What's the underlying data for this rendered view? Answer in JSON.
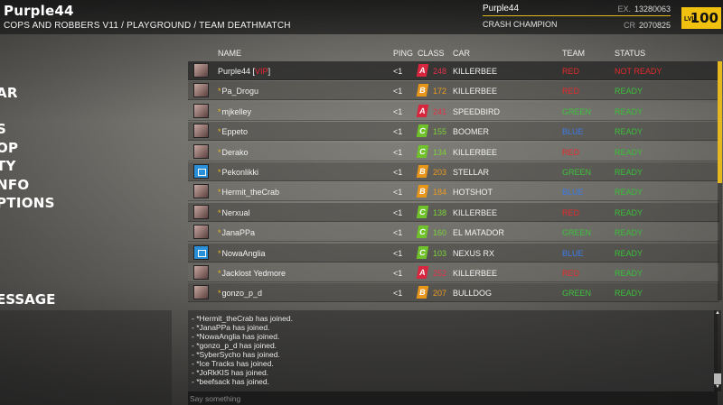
{
  "header": {
    "player_title": "Purple44",
    "breadcrumb": "COPS AND ROBBERS V11 / PLAYGROUND / TEAM DEATHMATCH"
  },
  "profile": {
    "name": "Purple44",
    "rank": "CRASH CHAMPION",
    "ex_label": "EX.",
    "ex_value": "13280063",
    "cr_label": "CR",
    "cr_value": "2070825",
    "lvl_label": "LVL",
    "lvl_value": "100"
  },
  "side_menu": {
    "items": [
      "AR",
      "S",
      "OP",
      "TY",
      "NFO",
      "PTIONS"
    ],
    "message_label": "ESSAGE"
  },
  "columns": {
    "name": "NAME",
    "ping": "PING",
    "class": "CLASS",
    "car": "CAR",
    "team": "TEAM",
    "status": "STATUS"
  },
  "players": [
    {
      "name": "Purple44",
      "tag": "VIP",
      "is_self": true,
      "ping": "<1",
      "class_letter": "A",
      "class_value": "248",
      "car": "KILLERBEE",
      "team": "RED",
      "status": "NOT READY",
      "avatar": "photo"
    },
    {
      "name": "Pa_Drogu",
      "star": "*",
      "ping": "<1",
      "class_letter": "B",
      "class_value": "172",
      "car": "KILLERBEE",
      "team": "RED",
      "status": "READY",
      "avatar": "photo"
    },
    {
      "name": "mjkelley",
      "star": "*",
      "ping": "<1",
      "class_letter": "A",
      "class_value": "241",
      "car": "SPEEDBIRD",
      "team": "GREEN",
      "status": "READY",
      "avatar": "photo"
    },
    {
      "name": "Eppeto",
      "star": "*",
      "ping": "<1",
      "class_letter": "C",
      "class_value": "155",
      "car": "BOOMER",
      "team": "BLUE",
      "status": "READY",
      "avatar": "photo"
    },
    {
      "name": "Derako",
      "star": "*",
      "ping": "<1",
      "class_letter": "C",
      "class_value": "134",
      "car": "KILLERBEE",
      "team": "RED",
      "status": "READY",
      "avatar": "photo"
    },
    {
      "name": "Pekonlikki",
      "star": "*",
      "ping": "<1",
      "class_letter": "B",
      "class_value": "203",
      "car": "STELLAR",
      "team": "GREEN",
      "status": "READY",
      "avatar": "steam"
    },
    {
      "name": "Hermit_theCrab",
      "star": "*",
      "ping": "<1",
      "class_letter": "B",
      "class_value": "184",
      "car": "HOTSHOT",
      "team": "BLUE",
      "status": "READY",
      "avatar": "photo"
    },
    {
      "name": "Nerxual",
      "star": "*",
      "ping": "<1",
      "class_letter": "C",
      "class_value": "138",
      "car": "KILLERBEE",
      "team": "RED",
      "status": "READY",
      "avatar": "photo"
    },
    {
      "name": "JanaPPa",
      "star": "*",
      "ping": "<1",
      "class_letter": "C",
      "class_value": "160",
      "car": "EL MATADOR",
      "team": "GREEN",
      "status": "READY",
      "avatar": "photo"
    },
    {
      "name": "NowaAnglia",
      "star": "*",
      "ping": "<1",
      "class_letter": "C",
      "class_value": "103",
      "car": "NEXUS RX",
      "team": "BLUE",
      "status": "READY",
      "avatar": "steam"
    },
    {
      "name": "Jacklost Yedmore",
      "star": "*",
      "ping": "<1",
      "class_letter": "A",
      "class_value": "252",
      "car": "KILLERBEE",
      "team": "RED",
      "status": "READY",
      "avatar": "photo"
    },
    {
      "name": "gonzo_p_d",
      "star": "*",
      "ping": "<1",
      "class_letter": "B",
      "class_value": "207",
      "car": "BULLDOG",
      "team": "GREEN",
      "status": "READY",
      "avatar": "photo"
    }
  ],
  "chat": {
    "lines": [
      "- *Hermit_theCrab has joined.",
      "- *JanaPPa has joined.",
      "- *NowaAnglia has joined.",
      "- *gonzo_p_d has joined.",
      "- *SyberSycho has joined.",
      "- *Ice Tracks has joined.",
      "- *JoRkKIS has joined.",
      "- *beefsack has joined."
    ],
    "placeholder": "Say something"
  },
  "colors": {
    "accent": "#e5b820",
    "red_team": "#e22b2b",
    "green_team": "#3ec23e",
    "blue_team": "#3a7be8",
    "class_a": "#d7263d",
    "class_b": "#e8961a",
    "class_c": "#70c22a"
  }
}
